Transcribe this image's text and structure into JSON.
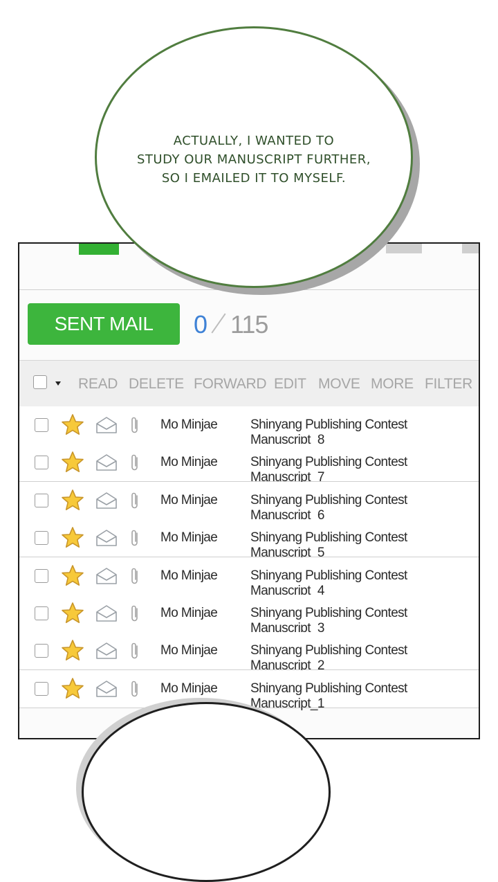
{
  "speech_bubble": {
    "lines": [
      "ACTUALLY, I WANTED TO",
      "STUDY OUR MANUSCRIPT FURTHER,",
      "SO I EMAILED IT TO MYSELF."
    ]
  },
  "mailbox": {
    "folder_button": "SENT MAIL",
    "unread_count": "0",
    "total_count": "115"
  },
  "toolbar": {
    "read": "READ",
    "delete": "DELETE",
    "forward": "FORWARD",
    "edit": "EDIT",
    "move": "MOVE",
    "more": "MORE",
    "filter": "FILTER"
  },
  "emails": [
    {
      "sender": "Mo Minjae",
      "subject": "Shinyang Publishing Contest Manuscript_8"
    },
    {
      "sender": "Mo Minjae",
      "subject": "Shinyang Publishing Contest Manuscript_7"
    },
    {
      "sender": "Mo Minjae",
      "subject": "Shinyang Publishing Contest Manuscript_6"
    },
    {
      "sender": "Mo Minjae",
      "subject": "Shinyang Publishing Contest Manuscript_5"
    },
    {
      "sender": "Mo Minjae",
      "subject": "Shinyang Publishing Contest Manuscript_4"
    },
    {
      "sender": "Mo Minjae",
      "subject": "Shinyang Publishing Contest Manuscript_3"
    },
    {
      "sender": "Mo Minjae",
      "subject": "Shinyang Publishing Contest Manuscript_2"
    },
    {
      "sender": "Mo Minjae",
      "subject": "Shinyang Publishing Contest Manuscript_1"
    }
  ],
  "icons": {
    "select": "checkbox-icon",
    "dropdown": "caret-down-icon",
    "star": "star-icon",
    "read_status": "envelope-open-icon",
    "attachment": "paperclip-icon"
  },
  "colors": {
    "accent_green": "#3db53d",
    "unread_blue": "#3f82d6",
    "star_yellow": "#f7c93a",
    "bubble_outline": "#507d3f"
  }
}
